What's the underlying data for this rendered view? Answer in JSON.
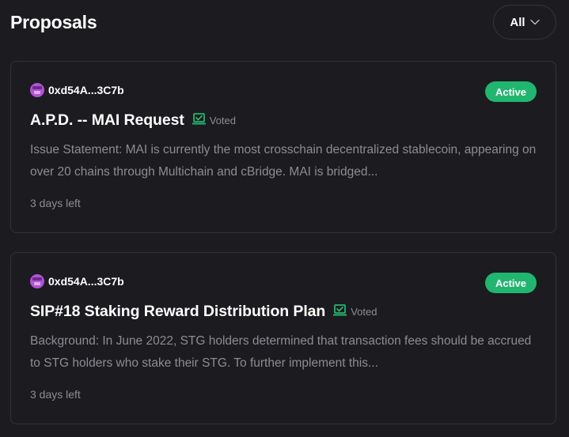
{
  "header": {
    "title": "Proposals",
    "filter_label": "All"
  },
  "proposals": [
    {
      "author": "0xd54A...3C7b",
      "status": "Active",
      "title": "A.P.D. -- MAI Request",
      "voted_label": "Voted",
      "body": "Issue Statement: MAI is currently the most crosschain decentralized stablecoin, appearing on over 20 chains through Multichain and cBridge. MAI is bridged...",
      "time_left": "3 days left"
    },
    {
      "author": "0xd54A...3C7b",
      "status": "Active",
      "title": "SIP#18 Staking Reward Distribution Plan",
      "voted_label": "Voted",
      "body": "Background: In June 2022, STG holders determined that transaction fees should be accrued to STG holders who stake their STG. To further implement this...",
      "time_left": "3 days left"
    }
  ],
  "colors": {
    "background": "#1c1b1f",
    "card_border": "#333238",
    "accent_green": "#21b66f",
    "muted_text": "#8e8c93"
  },
  "icons": {
    "filter": "chevron-down-icon",
    "voted": "check-box-icon",
    "avatar": "identicon-avatar"
  }
}
